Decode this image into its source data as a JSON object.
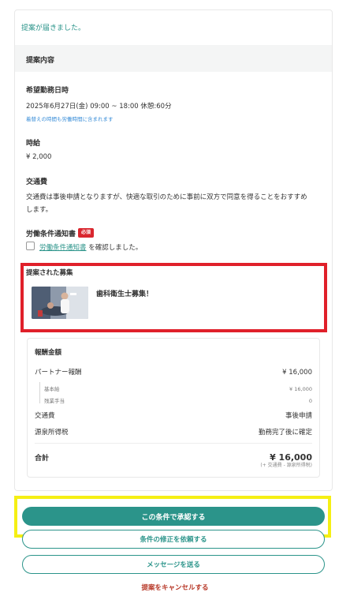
{
  "notice": "提案が届きました。",
  "section_header": "提案内容",
  "schedule": {
    "label": "希望勤務日時",
    "value": "2025年6月27日(金)  09:00 ~ 18:00 休憩:60分",
    "note": "着替えの時間も労働時間に含まれます"
  },
  "hourly": {
    "label": "時給",
    "value": "¥ 2,000"
  },
  "transport": {
    "label": "交通費",
    "line1": "交通費は事後申請となりますが、快適な取引のために事前に双方で同意を得ることをおすすめ",
    "line2": "します。"
  },
  "labor_notice": {
    "label": "労働条件通知書",
    "badge": "必須",
    "link_text": "労働条件通知書",
    "suffix": "を確認しました。"
  },
  "proposal": {
    "title": "提案された募集",
    "job_title": "歯科衛生士募集！"
  },
  "reward": {
    "title": "報酬金額",
    "partner_label": "パートナー報酬",
    "partner_value": "¥ 16,000",
    "base_label": "基本給",
    "base_value": "¥ 16,000",
    "overtime_label": "残業手当",
    "overtime_value": "0",
    "transport_label": "交通費",
    "transport_value": "事後申請",
    "tax_label": "源泉所得税",
    "tax_value": "勤務完了後に確定",
    "total_label": "合計",
    "total_value": "¥ 16,000",
    "total_note": "(+ 交通費 - 源泉所得税)"
  },
  "buttons": {
    "approve": "この条件で承認する",
    "request_change": "条件の修正を依頼する",
    "message": "メッセージを送る",
    "cancel": "提案をキャンセルする"
  },
  "colors": {
    "accent": "#2b948a",
    "required_badge": "#d9262e",
    "highlight_red": "#e0202a",
    "highlight_yellow": "#f5ef14",
    "cancel_text": "#b83a2a"
  }
}
